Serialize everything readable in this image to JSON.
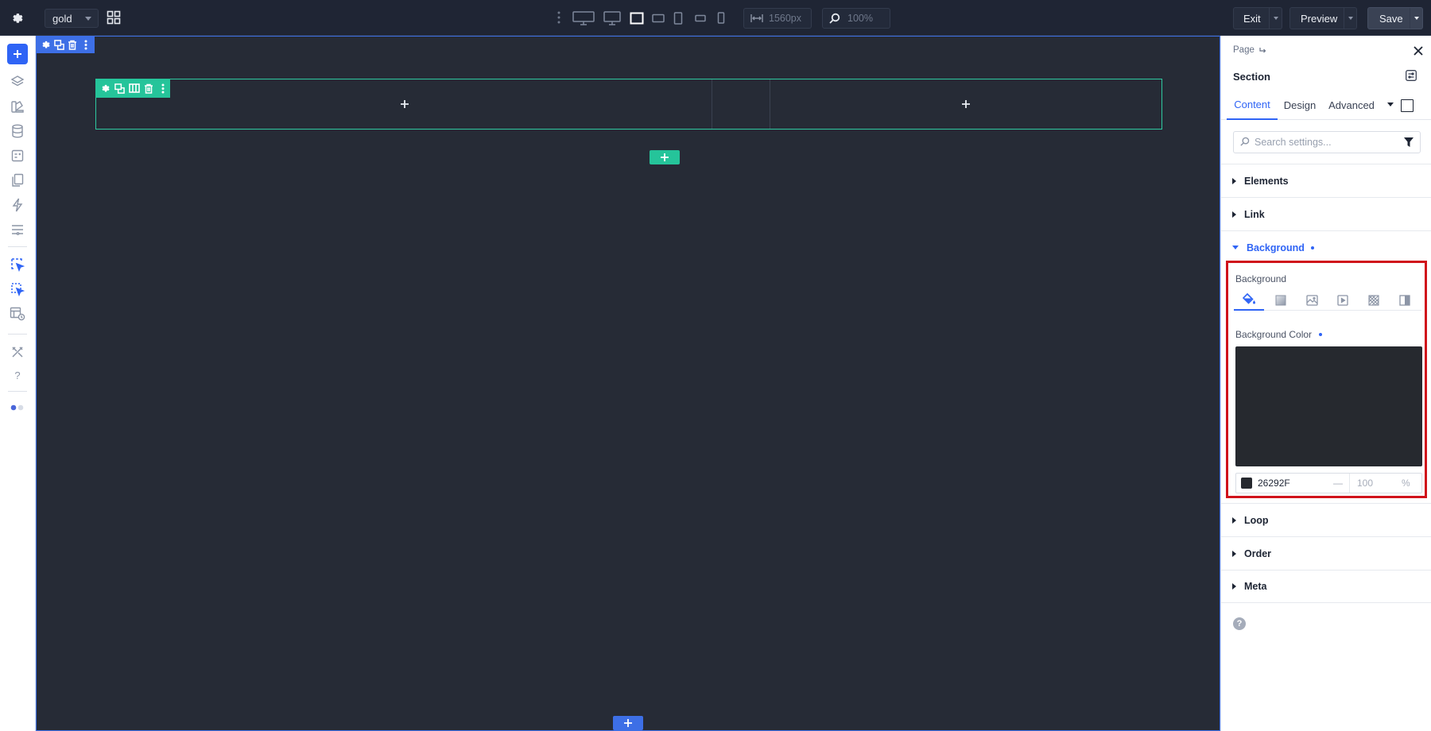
{
  "topbar": {
    "page_name": "gold",
    "devices": [
      "desktop-wide",
      "desktop",
      "laptop",
      "tablet-landscape",
      "tablet-portrait",
      "mobile-landscape",
      "mobile-portrait"
    ],
    "active_device": "laptop",
    "width_value": "1560px",
    "zoom_value": "100%",
    "exit_label": "Exit",
    "preview_label": "Preview",
    "save_label": "Save"
  },
  "sidebar": {
    "items": [
      "add-element",
      "layers",
      "theme-styles",
      "database",
      "templates",
      "pages",
      "actions",
      "site-settings",
      "custom-element-a",
      "custom-element-b",
      "template-history",
      "tools",
      "help",
      "toggle"
    ]
  },
  "canvas": {
    "background": "#262b36",
    "section_outline": "#3d6fe6",
    "container_outline": "#2ec9a0",
    "column_count": 3
  },
  "panel": {
    "breadcrumb": "Page",
    "title": "Section",
    "tabs": [
      {
        "label": "Content",
        "active": true
      },
      {
        "label": "Design",
        "active": false
      },
      {
        "label": "Advanced",
        "active": false
      }
    ],
    "search_placeholder": "Search settings...",
    "accordions": {
      "elements": "Elements",
      "link": "Link",
      "background": "Background",
      "loop": "Loop",
      "order": "Order",
      "meta": "Meta"
    },
    "background": {
      "label": "Background",
      "types": [
        "color",
        "gradient",
        "image",
        "video",
        "pattern",
        "overlay"
      ],
      "active_type": "color",
      "color_label": "Background Color",
      "hex": "26292F",
      "color": "#26292f",
      "alpha_dash": "—",
      "alpha": "100",
      "alpha_unit": "%"
    },
    "help_glyph": "?",
    "accent_color": "#2f64f5",
    "highlight_color": "#d0121b"
  }
}
